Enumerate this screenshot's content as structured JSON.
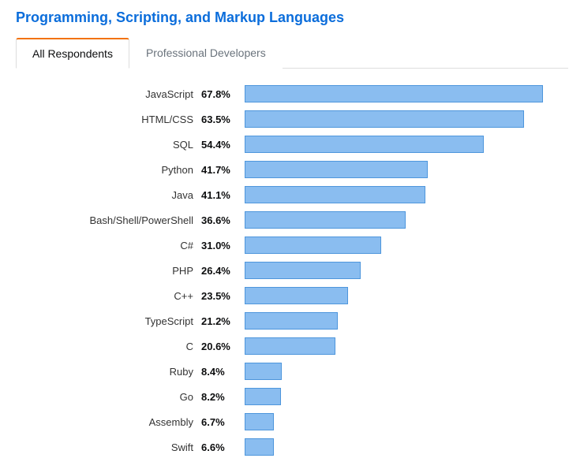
{
  "title": "Programming, Scripting, and Markup Languages",
  "tabs": [
    {
      "label": "All Respondents",
      "active": true
    },
    {
      "label": "Professional Developers",
      "active": false
    }
  ],
  "chart_data": {
    "type": "bar",
    "title": "Programming, Scripting, and Markup Languages",
    "xlabel": "",
    "ylabel": "",
    "ylim": [
      0,
      70
    ],
    "categories": [
      "JavaScript",
      "HTML/CSS",
      "SQL",
      "Python",
      "Java",
      "Bash/Shell/PowerShell",
      "C#",
      "PHP",
      "C++",
      "TypeScript",
      "C",
      "Ruby",
      "Go",
      "Assembly",
      "Swift"
    ],
    "values": [
      67.8,
      63.5,
      54.4,
      41.7,
      41.1,
      36.6,
      31.0,
      26.4,
      23.5,
      21.2,
      20.6,
      8.4,
      8.2,
      6.7,
      6.6
    ]
  }
}
